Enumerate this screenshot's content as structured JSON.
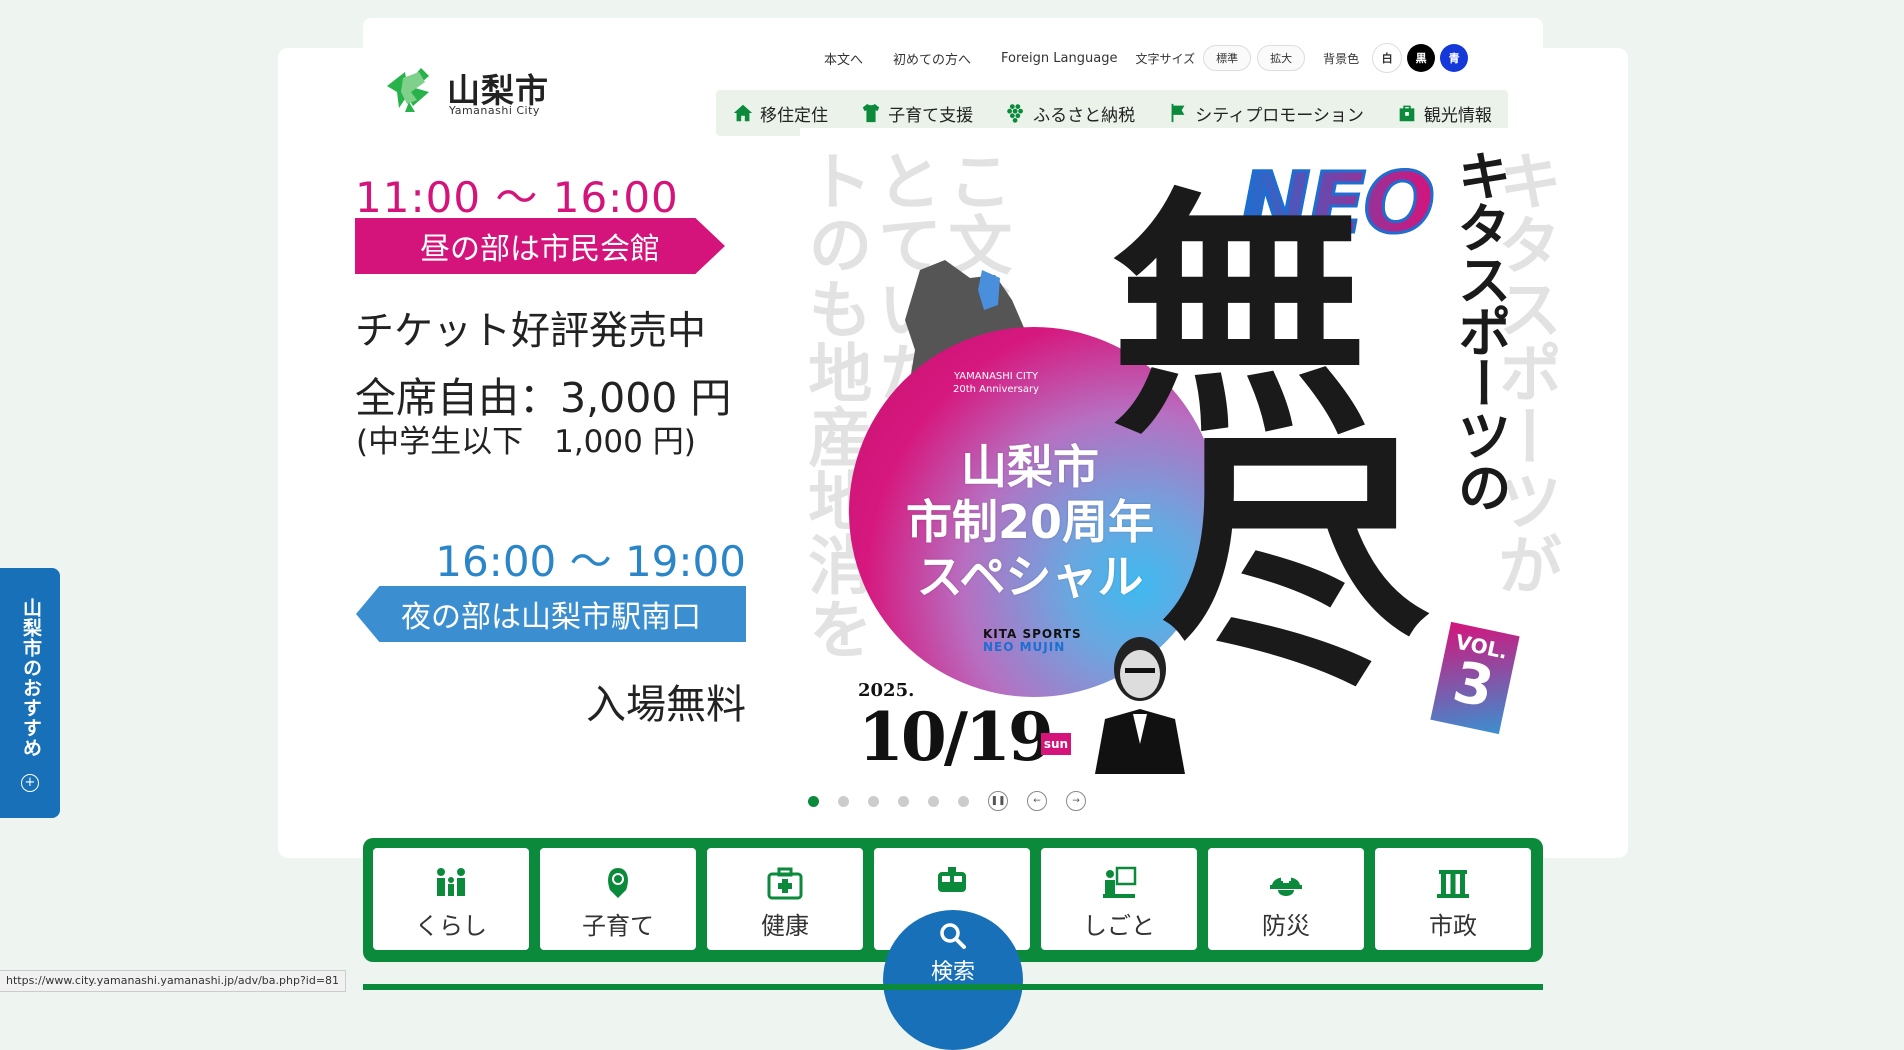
{
  "site": {
    "name": "山梨市",
    "name_en": "Yamanashi City"
  },
  "utility": {
    "skip_link": "本文へ",
    "first_time": "初めての方へ",
    "foreign_language": "Foreign Language",
    "font_size_label": "文字サイズ",
    "font_standard": "標準",
    "font_large": "拡大",
    "bg_color_label": "背景色",
    "bg_white": "白",
    "bg_black": "黒",
    "bg_blue": "青"
  },
  "main_nav": [
    {
      "label": "移住定住",
      "icon": "house-icon"
    },
    {
      "label": "子育て支援",
      "icon": "clothes-icon"
    },
    {
      "label": "ふるさと納税",
      "icon": "grapes-icon"
    },
    {
      "label": "シティプロモーション",
      "icon": "flag-icon"
    },
    {
      "label": "観光情報",
      "icon": "bag-icon"
    }
  ],
  "hero": {
    "day_time": "11:00 〜 16:00",
    "day_banner": "昼の部は市民会館",
    "ticket_status": "チケット好評発売中",
    "price": "全席自由：3,000 円",
    "price_sub": "(中学生以下　1,000 円)",
    "night_time": "16:00 〜 19:00",
    "night_banner": "夜の部は山梨市駅南口",
    "night_free": "入場無料"
  },
  "poster": {
    "neo": "NEO",
    "vertical_title": "キタスポーツの",
    "big_kanji_1": "無",
    "big_kanji_2": "尽",
    "city_tag": "YAMANASHI CITY",
    "anniversary_tag": "20th Anniversary",
    "circle_title_1": "山梨市",
    "circle_title_2": "市制20周年",
    "circle_title_3": "スペシャル",
    "vol_label": "VOL.",
    "vol_number": "3",
    "neo_tag_1": "KITA SPORTS",
    "neo_tag_2": "NEO MUJIN",
    "date_year": "2025.",
    "date": "10/19",
    "date_dow": "sun",
    "bg_chars": [
      "トのも地産地消を",
      "とていた",
      "こ文化",
      "キタスポーツが",
      "ツ"
    ]
  },
  "carousel": {
    "slide_count": 6,
    "active_index": 0
  },
  "categories": [
    {
      "label": "くらし",
      "icon": "family-icon"
    },
    {
      "label": "子育て",
      "icon": "baby-icon"
    },
    {
      "label": "健康",
      "icon": "medical-kit-icon"
    },
    {
      "label": "",
      "icon": "train-icon"
    },
    {
      "label": "しごと",
      "icon": "work-icon"
    },
    {
      "label": "防災",
      "icon": "helmet-icon"
    },
    {
      "label": "市政",
      "icon": "city-hall-icon"
    }
  ],
  "search": {
    "label": "検索"
  },
  "side_tab": {
    "label": "山梨市のおすすめ"
  },
  "status_url": "https://www.city.yamanashi.yamanashi.jp/adv/ba.php?id=81",
  "colors": {
    "brand_green": "#0a8a3a",
    "magenta": "#d4147b",
    "blue": "#1770b8"
  }
}
